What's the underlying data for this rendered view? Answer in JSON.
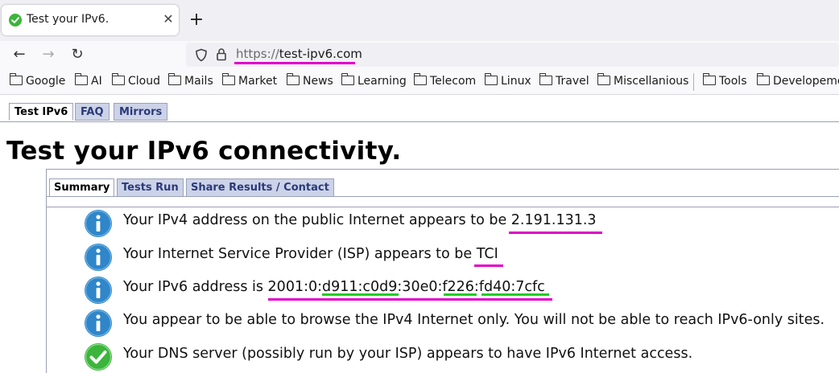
{
  "browser": {
    "tab_title": "Test your IPv6.",
    "tab_close": "✕",
    "new_tab": "+",
    "url_scheme": "https://",
    "url_host": "test-ipv6.com",
    "back": "←",
    "forward": "→",
    "reload": "↻"
  },
  "bookmarks": [
    "Google",
    "AI",
    "Cloud",
    "Mails",
    "Market",
    "News",
    "Learning",
    "Telecom",
    "Linux",
    "Travel",
    "Miscellanious",
    "Tools",
    "Developeme"
  ],
  "site_tabs": [
    "Test IPv6",
    "FAQ",
    "Mirrors"
  ],
  "heading": "Test your IPv6 connectivity.",
  "inner_tabs": [
    "Summary",
    "Tests Run",
    "Share Results / Contact"
  ],
  "results": [
    {
      "icon": "info-icon",
      "text": "Your IPv4 address on the public Internet appears to be 2.191.131.3"
    },
    {
      "icon": "info-icon",
      "text": "Your Internet Service Provider (ISP) appears to be TCI"
    },
    {
      "icon": "info-icon",
      "text": "Your IPv6 address is 2001:0:d911:c0d9:30e0:f226:fd40:7cfc"
    },
    {
      "icon": "info-icon",
      "text": "You appear to be able to browse the IPv4 Internet only. You will not be able to reach IPv6-only sites."
    },
    {
      "icon": "check-icon",
      "text": "Your DNS server (possibly run by your ISP) appears to have IPv6 Internet access."
    }
  ],
  "colors": {
    "annotation_magenta": "#e000c8",
    "annotation_green": "#22cc22",
    "info_blue": "#2f86c9",
    "check_green": "#3bb53b",
    "tab_bg": "#ccd3e8",
    "tab_text": "#2b3a7a"
  }
}
